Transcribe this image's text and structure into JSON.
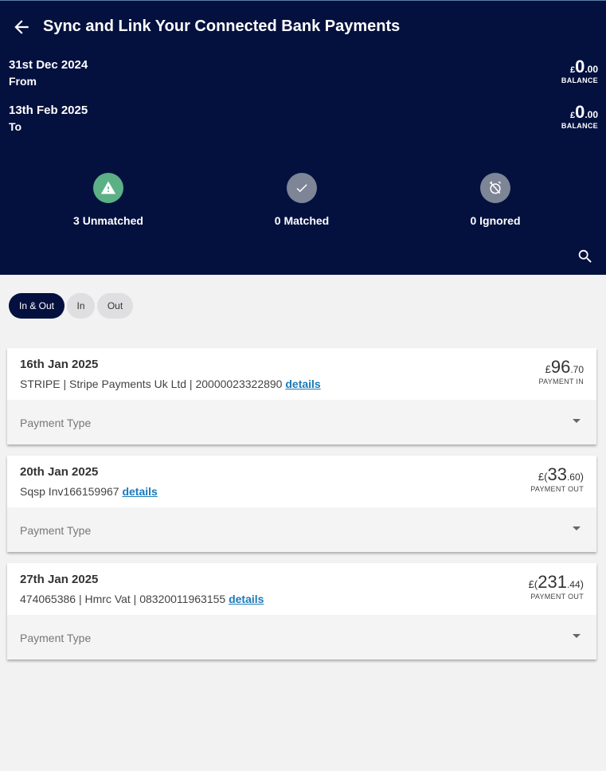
{
  "header": {
    "title": "Sync and Link Your Connected Bank Payments",
    "from": {
      "date": "31st Dec 2024",
      "label": "From",
      "currency": "£",
      "major": "0",
      "minor": ".00",
      "caption": "BALANCE"
    },
    "to": {
      "date": "13th Feb 2025",
      "label": "To",
      "currency": "£",
      "major": "0",
      "minor": ".00",
      "caption": "BALANCE"
    }
  },
  "stats": [
    {
      "label": "3 Unmatched",
      "icon": "warning-icon",
      "color": "#5cb085"
    },
    {
      "label": "0 Matched",
      "icon": "check-icon",
      "color": "#7d8596"
    },
    {
      "label": "0 Ignored",
      "icon": "alarm-off-icon",
      "color": "#7d8596"
    }
  ],
  "filters": [
    "In & Out",
    "In",
    "Out"
  ],
  "transactions": [
    {
      "date": "16th Jan 2025",
      "description": "STRIPE | Stripe Payments Uk Ltd | 20000023322890",
      "link": "details",
      "currency": "£",
      "open": "",
      "major": "96",
      "minor": ".70",
      "close": "",
      "caption": "PAYMENT IN",
      "payment_type": "Payment Type"
    },
    {
      "date": "20th Jan 2025",
      "description": "Sqsp Inv166159967",
      "link": "details",
      "currency": "£",
      "open": "(",
      "major": "33",
      "minor": ".60",
      "close": ")",
      "caption": "PAYMENT OUT",
      "payment_type": "Payment Type"
    },
    {
      "date": "27th Jan 2025",
      "description": "474065386 | Hmrc Vat | 08320011963155",
      "link": "details",
      "currency": "£",
      "open": "(",
      "major": "231",
      "minor": ".44",
      "close": ")",
      "caption": "PAYMENT OUT",
      "payment_type": "Payment Type"
    }
  ]
}
